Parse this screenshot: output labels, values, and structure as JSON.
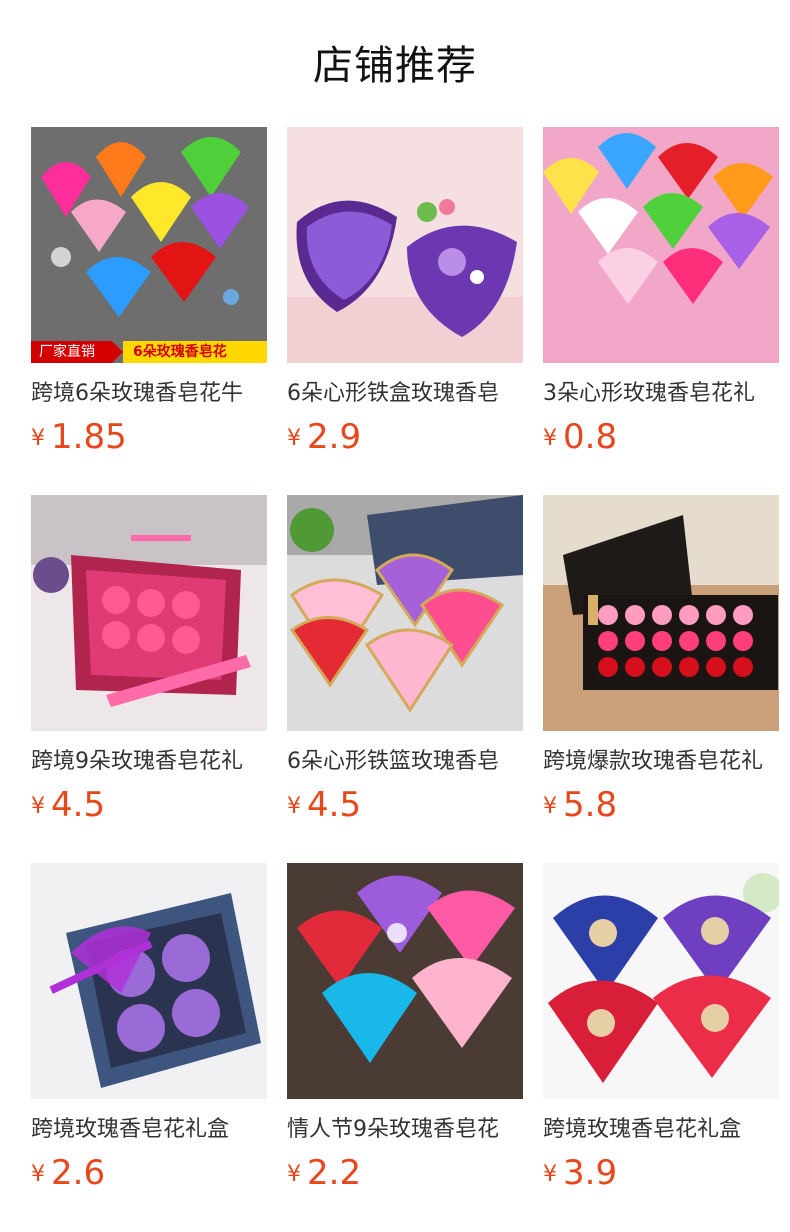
{
  "page": {
    "title": "店铺推荐"
  },
  "products": [
    {
      "name": "跨境6朵玫瑰香皂花牛",
      "currency": "¥",
      "price": "1.85",
      "banner_left": "厂家直销",
      "banner_right": "6朵玫瑰香皂花"
    },
    {
      "name": "6朵心形铁盒玫瑰香皂",
      "currency": "¥",
      "price": "2.9"
    },
    {
      "name": "3朵心形玫瑰香皂花礼",
      "currency": "¥",
      "price": "0.8"
    },
    {
      "name": "跨境9朵玫瑰香皂花礼",
      "currency": "¥",
      "price": "4.5"
    },
    {
      "name": "6朵心形铁篮玫瑰香皂",
      "currency": "¥",
      "price": "4.5"
    },
    {
      "name": "跨境爆款玫瑰香皂花礼",
      "currency": "¥",
      "price": "5.8"
    },
    {
      "name": "跨境玫瑰香皂花礼盒",
      "currency": "¥",
      "price": "2.6"
    },
    {
      "name": "情人节9朵玫瑰香皂花",
      "currency": "¥",
      "price": "2.2"
    },
    {
      "name": "跨境玫瑰香皂花礼盒",
      "currency": "¥",
      "price": "3.9"
    }
  ],
  "colors": {
    "price": "#e8471c",
    "title": "#111111",
    "name": "#333333"
  }
}
